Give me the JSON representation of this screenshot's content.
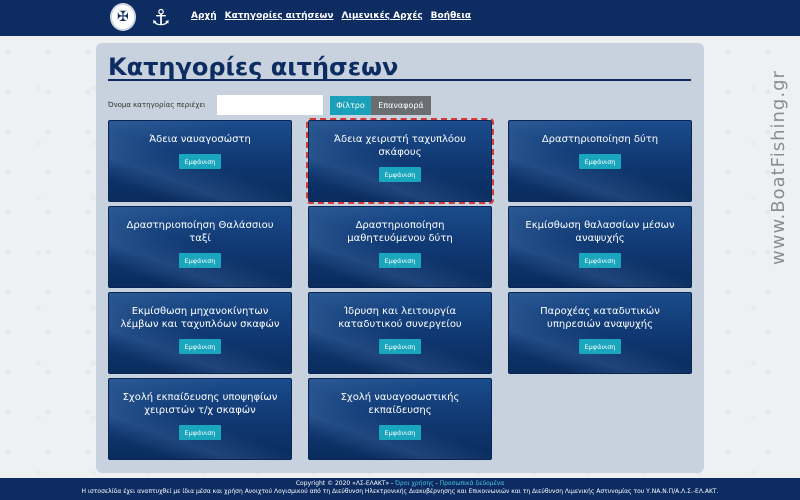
{
  "header": {
    "nav": [
      "Αρχή",
      "Κατηγορίες αιτήσεων",
      "Λιμενικές Αρχές",
      "Βοήθεια"
    ]
  },
  "page": {
    "title": "Κατηγορίες αιτήσεων",
    "filter_label": "Όνομα κατηγορίας περιέχει",
    "filter_value": "",
    "filter_button": "Φίλτρο",
    "reset_button": "Επαναφορά"
  },
  "cards": [
    {
      "title": "Άδεια ναυαγοσώστη",
      "button": "Εμφάνιση"
    },
    {
      "title": "Άδεια χειριστή ταχυπλόου σκάφους",
      "button": "Εμφάνιση"
    },
    {
      "title": "Δραστηριοποίηση δύτη",
      "button": "Εμφάνιση"
    },
    {
      "title": "Δραστηριοποίηση Θαλάσσιου ταξί",
      "button": "Εμφάνιση"
    },
    {
      "title": "Δραστηριοποίηση μαθητευόμενου δύτη",
      "button": "Εμφάνιση"
    },
    {
      "title": "Εκμίσθωση θαλασσίων μέσων αναψυχής",
      "button": "Εμφάνιση"
    },
    {
      "title": "Εκμίσθωση μηχανοκίνητων λέμβων και ταχυπλόων σκαφών",
      "button": "Εμφάνιση"
    },
    {
      "title": "Ίδρυση και λειτουργία καταδυτικού συνεργείου",
      "button": "Εμφάνιση"
    },
    {
      "title": "Παροχέας καταδυτικών υπηρεσιών αναψυχής",
      "button": "Εμφάνιση"
    },
    {
      "title": "Σχολή εκπαίδευσης υποψηφίων χειριστών τ/χ σκαφών",
      "button": "Εμφάνιση"
    },
    {
      "title": "Σχολή ναυαγοσωστικής εκπαίδευσης",
      "button": "Εμφάνιση"
    }
  ],
  "footer": {
    "copyright": "Copyright © 2020 «ΛΣ-ΕΛΑΚΤ» -",
    "terms": "Όροι χρήσης",
    "sep": "-",
    "privacy": "Προσωπικά δεδομένα",
    "line2": "Η ιστοσελίδα έχει αναπτυχθεί με ίδια μέσα και χρήση Ανοιχτού Λογισμικού από τη Διεύθυνση Ηλεκτρονικής Διακυβέρνησης και Επικοινωνιών και τη Διεύθυνση Λιμενικής Αστυνομίας του Υ.ΝΑ.Ν.Π/Α.Λ.Σ.-ΕΛ.ΑΚΤ."
  },
  "watermark": "www.BoatFishing.gr",
  "colors": {
    "brand": "#0d2d62",
    "accent": "#1aa6bd",
    "reset": "#6a6e73",
    "selected_outline": "#d23a3a"
  }
}
